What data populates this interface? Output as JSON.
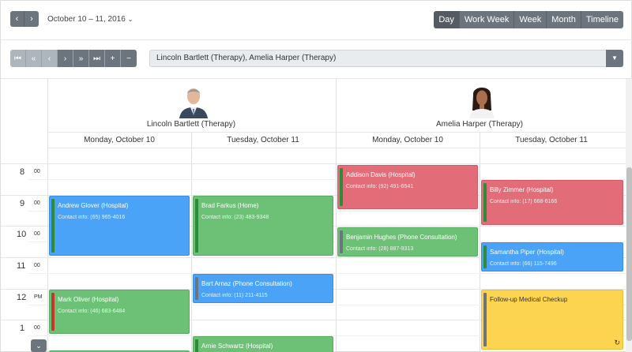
{
  "header": {
    "date_range": "October 10 – 11, 2016",
    "views": [
      "Day",
      "Work Week",
      "Week",
      "Month",
      "Timeline"
    ]
  },
  "resource_select": {
    "value": "Lincoln Bartlett (Therapy), Amelia Harper (Therapy)"
  },
  "resources": [
    {
      "name": "Lincoln Bartlett (Therapy)"
    },
    {
      "name": "Amelia Harper (Therapy)"
    }
  ],
  "days": [
    "Monday, October 10",
    "Tuesday, October 11",
    "Monday, October 10",
    "Tuesday, October 11"
  ],
  "times": [
    {
      "hour": "8",
      "min": "00"
    },
    {
      "hour": "9",
      "min": "00"
    },
    {
      "hour": "10",
      "min": "00"
    },
    {
      "hour": "11",
      "min": "00"
    },
    {
      "hour": "12",
      "min": "PM"
    },
    {
      "hour": "1",
      "min": "00"
    }
  ],
  "appointments": [
    {
      "title": "Andrew Glover (Hospital)",
      "contact": "Contact info: (65) 965-4016"
    },
    {
      "title": "Mark Oliver (Hospital)",
      "contact": "Contact info: (46) 683-6484"
    },
    {
      "title": "Brad Farkus (Home)",
      "contact": "Contact info: (23) 483-9348"
    },
    {
      "title": "Bart Arnaz (Phone Consultation)",
      "contact": "Contact info: (11) 211-4115"
    },
    {
      "title": "Arnie Schwartz (Hospital)",
      "contact": ""
    },
    {
      "title": "Addison Davis (Hospital)",
      "contact": "Contact info: (92) 491-6541"
    },
    {
      "title": "Benjamin Hughes (Phone Consultation)",
      "contact": "Contact info: (28) 887-9313"
    },
    {
      "title": "Billy Zimmer (Hospital)",
      "contact": "Contact info: (17) 668-6166"
    },
    {
      "title": "Samantha Piper (Hospital)",
      "contact": "Contact info: (66) 115-7496"
    },
    {
      "title": "Follow-up Medical Checkup",
      "contact": ""
    }
  ],
  "colors": {
    "blue": "#4aa3f7",
    "green": "#6cc176",
    "red": "#e36c79",
    "yellow": "#fcd450",
    "toolbar": "#6c757d"
  }
}
